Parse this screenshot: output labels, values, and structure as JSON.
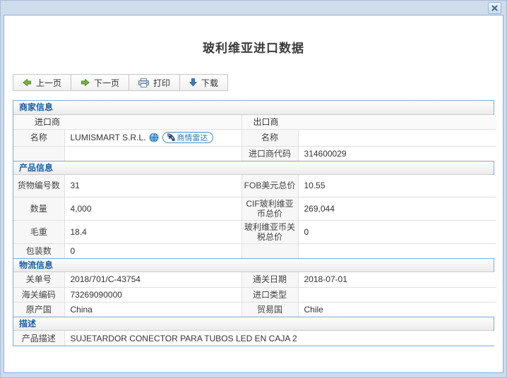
{
  "dialog": {
    "title": "玻利维亚进口数据"
  },
  "toolbar": {
    "prev_label": "上一页",
    "next_label": "下一页",
    "print_label": "打印",
    "download_label": "下载"
  },
  "icons": {
    "close": "close-icon",
    "prev": "arrow-left-green-icon",
    "next": "arrow-right-green-icon",
    "print": "printer-icon",
    "download": "download-arrow-blue-icon",
    "globe": "globe-icon",
    "radar": "radar-icon"
  },
  "colors": {
    "frame_bg": "#cfdcec",
    "panel_border": "#8cb0d8",
    "table_border": "#86aad2",
    "section_title_blue": "#1a5dab",
    "badge_blue": "#2b7bb9",
    "arrow_green": "#76b43f",
    "arrow_download_blue": "#3b78c3"
  },
  "sections": {
    "merchant": {
      "title": "商家信息",
      "subheaders": {
        "importer": "进口商",
        "exporter": "出口商"
      },
      "name_row": {
        "l1": "名称",
        "v1": "LUMISMART S.R.L.",
        "badge_label": "商情雷达",
        "l2": "名称",
        "v2": ""
      },
      "code_row": {
        "l1": "",
        "v1": "",
        "l2": "进口商代码",
        "v2": "314600029"
      }
    },
    "product": {
      "title": "产品信息",
      "rows": [
        {
          "l1": "货物编号数",
          "v1": "31",
          "l2": "FOB美元总价",
          "v2": "10.55"
        },
        {
          "l1": "数量",
          "v1": "4,000",
          "l2": "CIF玻利维亚币总价",
          "v2": "269,044"
        },
        {
          "l1": "毛重",
          "v1": "18.4",
          "l2": "玻利维亚币关税总价",
          "v2": "0"
        },
        {
          "l1": "包装数",
          "v1": "0",
          "l2": "",
          "v2": ""
        }
      ]
    },
    "logistics": {
      "title": "物流信息",
      "rows": [
        {
          "l1": "关单号",
          "v1": "2018/701/C-43754",
          "l2": "通关日期",
          "v2": "2018-07-01"
        },
        {
          "l1": "海关编码",
          "v1": "73269090000",
          "l2": "进口类型",
          "v2": ""
        },
        {
          "l1": "原产国",
          "v1": "China",
          "l2": "贸易国",
          "v2": "Chile"
        }
      ]
    },
    "description": {
      "title": "描述",
      "label": "产品描述",
      "value": "SUJETARDOR CONECTOR PARA TUBOS LED EN CAJA 2"
    }
  }
}
